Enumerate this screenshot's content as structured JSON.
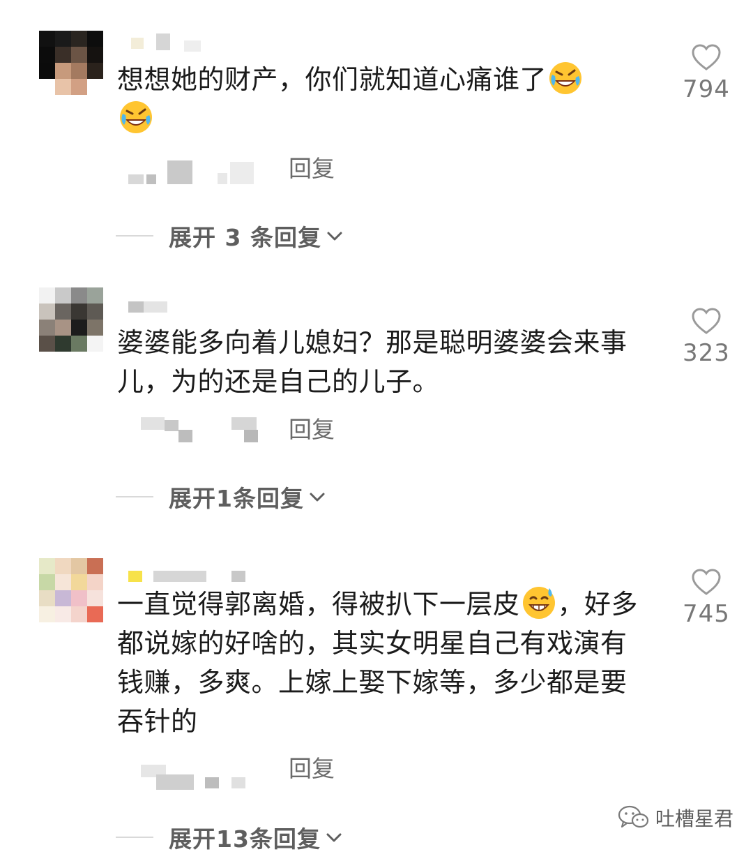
{
  "comments": [
    {
      "text_parts": [
        "想想她的财产，你们就知道心痛谁了"
      ],
      "emoji_names": [
        "rofl-emoji",
        "rofl-emoji"
      ],
      "reply_label": "回复",
      "expand_label": "展开 3 条回复",
      "likes": "794"
    },
    {
      "text": "婆婆能多向着儿媳妇？那是聪明婆婆会来事儿，为的还是自己的儿子。",
      "reply_label": "回复",
      "expand_label": "展开1条回复",
      "likes": "323"
    },
    {
      "text_a": "一直觉得郭离婚，得被扒下一层皮",
      "emoji_name": "grinning-sweat-emoji",
      "text_b": "，好多都说嫁的好啥的，其实女明星自己有戏演有钱赚，多爽。上嫁上娶下嫁等，多少都是要吞针的",
      "reply_label": "回复",
      "expand_label": "展开13条回复",
      "likes": "745"
    }
  ],
  "watermark": {
    "icon": "wechat-icon",
    "text": "吐槽星君"
  },
  "colors": {
    "text": "#1b1b1b",
    "muted": "#6a6a6a",
    "divider": "#d9d9d9",
    "heart": "#9a9a9a"
  }
}
